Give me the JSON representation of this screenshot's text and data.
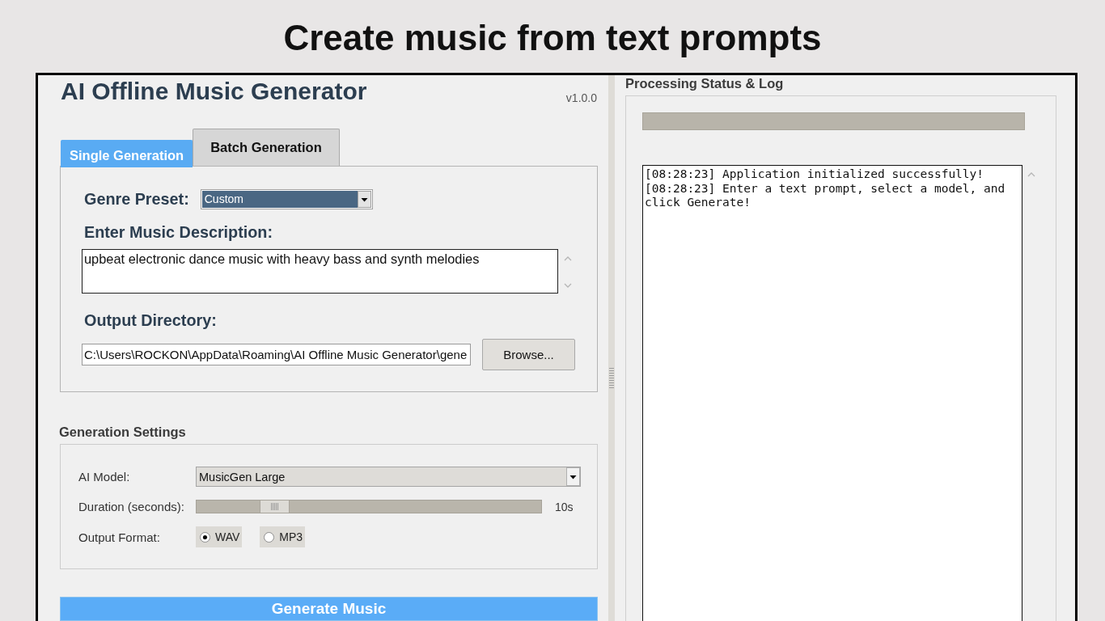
{
  "headline": "Create music from text prompts",
  "app": {
    "title": "AI Offline Music Generator",
    "version": "v1.0.0",
    "tabs": [
      {
        "label": "Single Generation",
        "selected": true
      },
      {
        "label": "Batch Generation",
        "selected": false
      }
    ],
    "single_generation": {
      "genre_preset": {
        "label": "Genre Preset:",
        "value": "Custom",
        "focused": true
      },
      "description": {
        "label": "Enter Music Description:",
        "value": "upbeat electronic dance music with heavy bass and synth melodies"
      },
      "output_directory": {
        "label": "Output Directory:",
        "value": "C:\\Users\\ROCKON\\AppData\\Roaming\\AI Offline Music Generator\\gene",
        "button": "Browse..."
      }
    },
    "generation_settings": {
      "title": "Generation Settings",
      "model": {
        "label": "AI Model:",
        "value": "MusicGen Large"
      },
      "duration": {
        "label": "Duration (seconds):",
        "level": 0.2,
        "reading": "10s"
      },
      "output_format": {
        "label": "Output Format:",
        "options": [
          {
            "label": "WAV",
            "selected": true
          },
          {
            "label": "MP3",
            "selected": false
          }
        ]
      }
    },
    "generate_button": "Generate Music",
    "status_panel": {
      "title": "Processing Status & Log",
      "progress": {
        "level": 0
      },
      "log": [
        "[08:28:23] Application initialized successfully!",
        "[08:28:23] Enter a text prompt, select a model, and click Generate!"
      ]
    }
  }
}
